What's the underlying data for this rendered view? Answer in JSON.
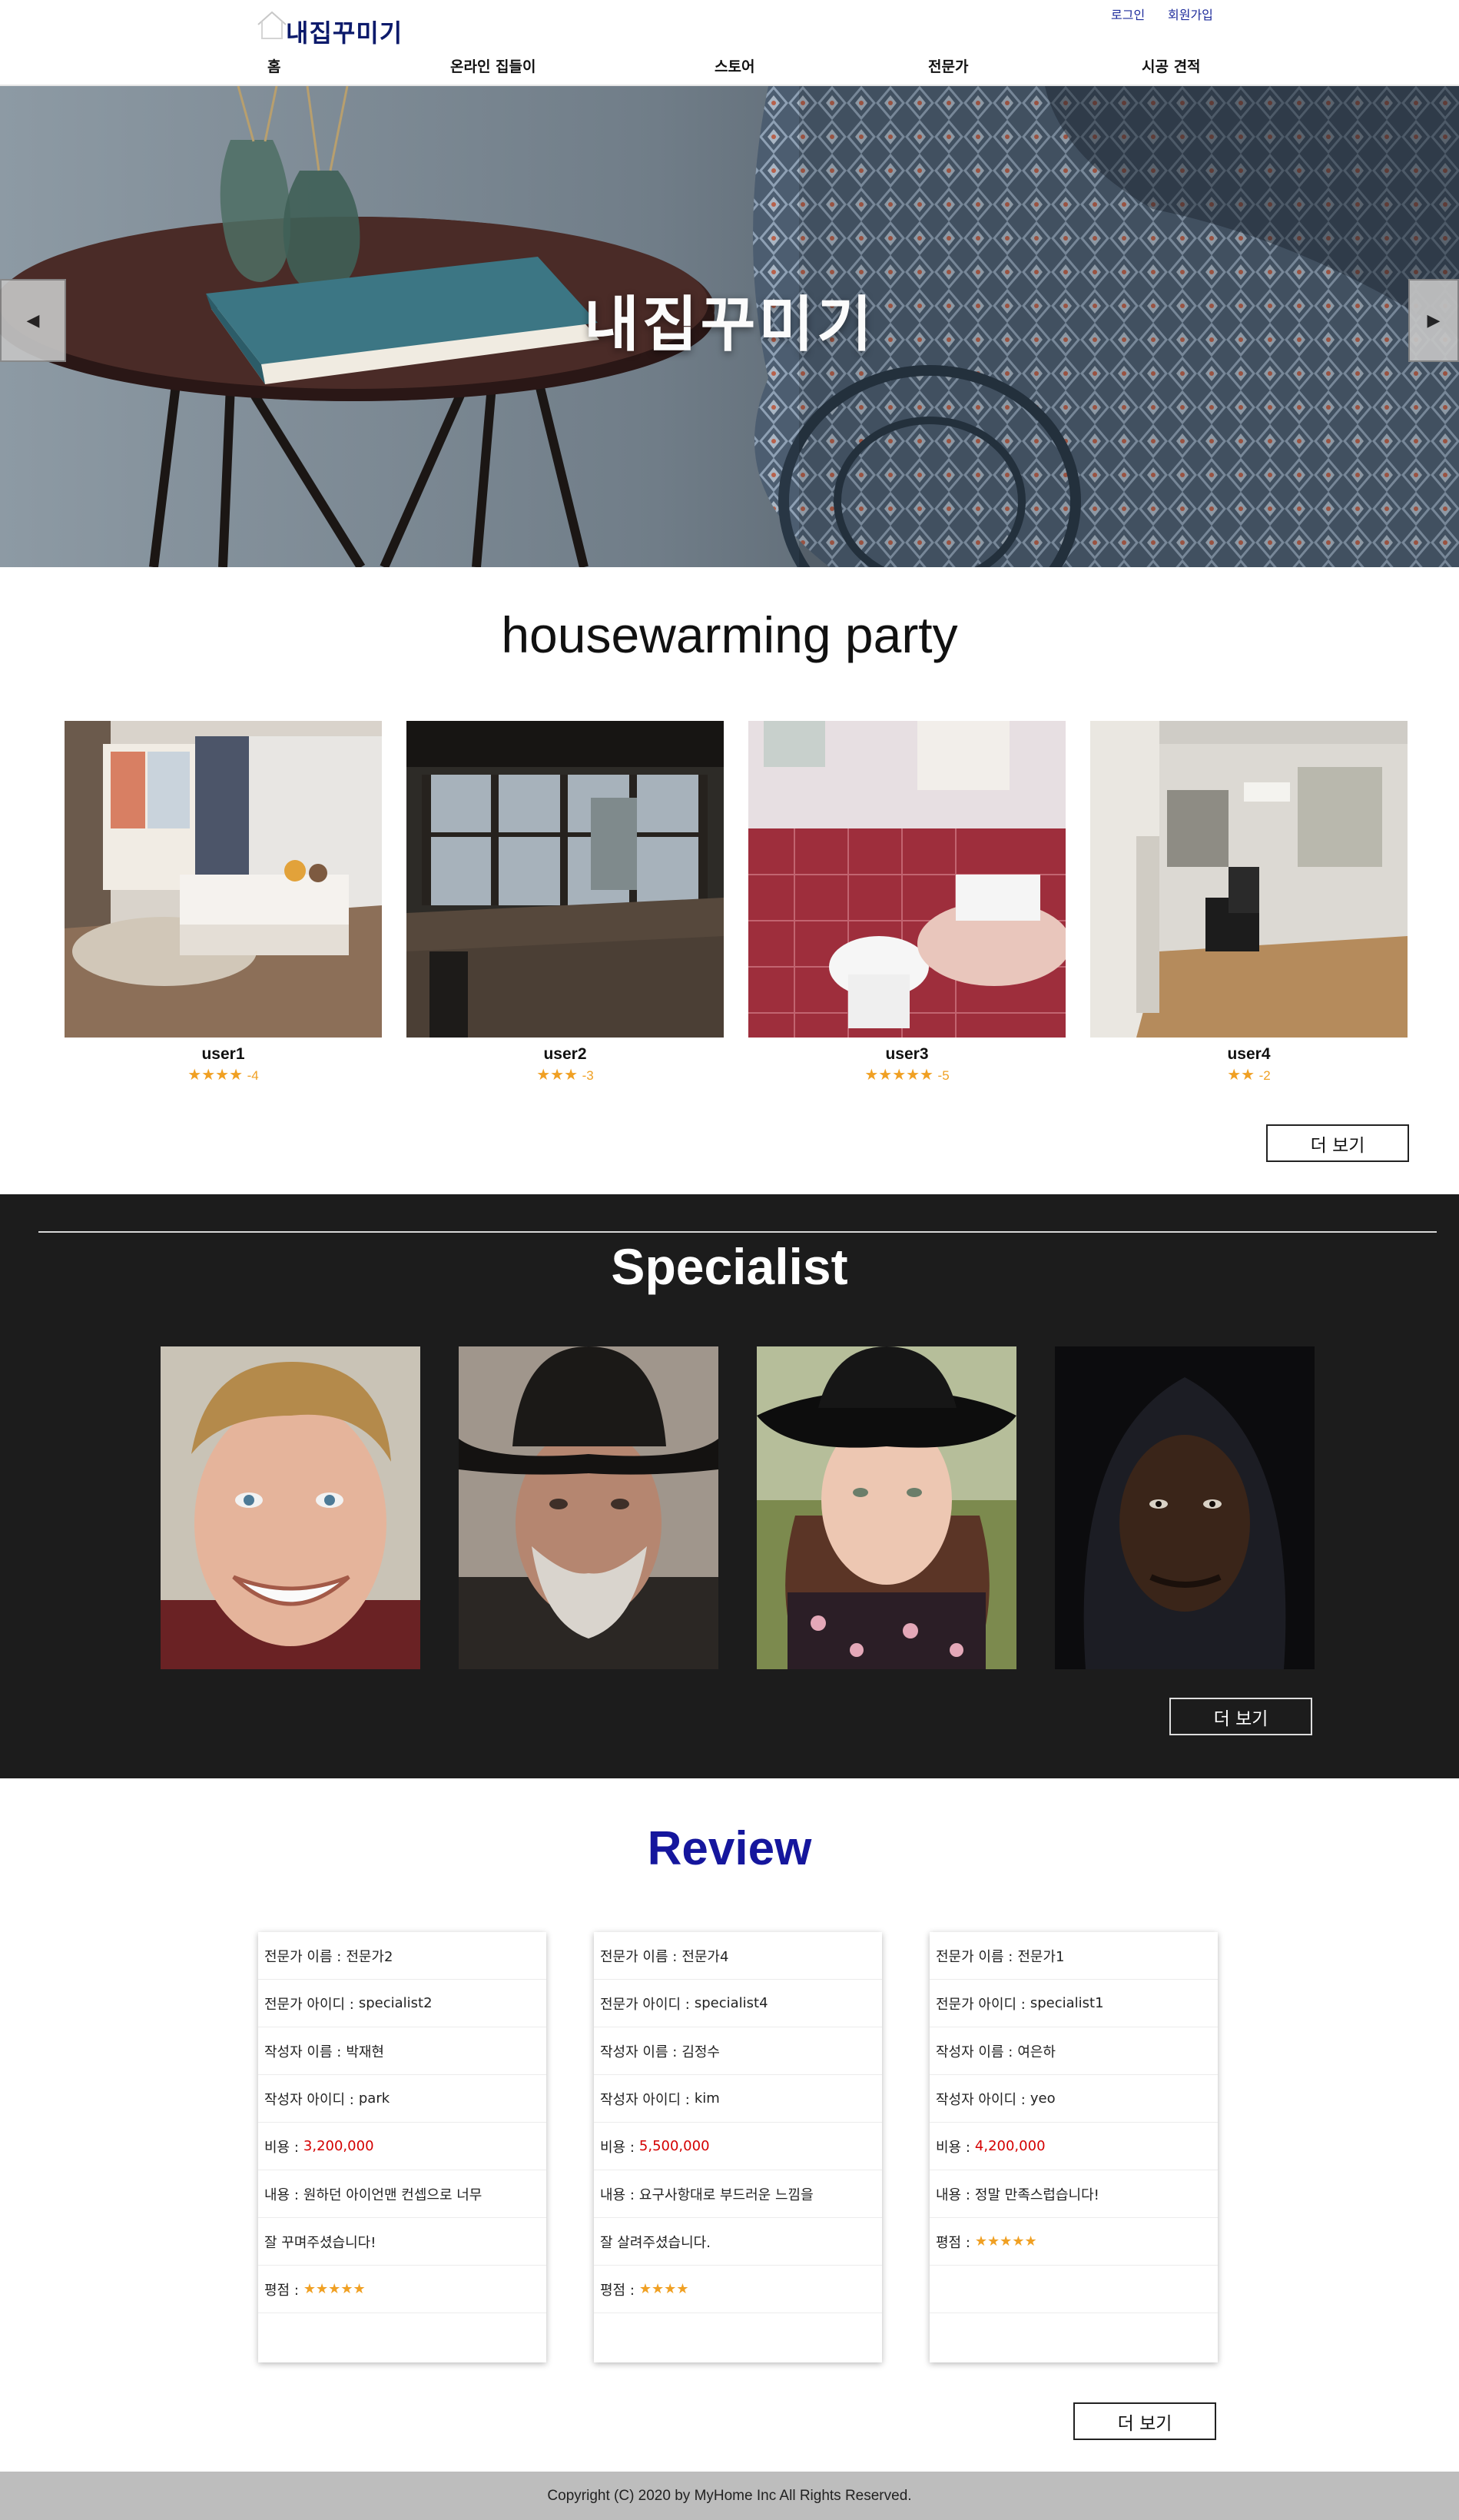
{
  "header": {
    "logo_text": "내집꾸미기",
    "login": "로그인",
    "signup": "회원가입",
    "nav": [
      "홈",
      "온라인 집들이",
      "스토어",
      "전문가",
      "시공 견적"
    ]
  },
  "hero": {
    "title": "내집꾸미기",
    "prev_icon": "◀",
    "next_icon": "▶"
  },
  "housewarming": {
    "title": "housewarming party",
    "cards": [
      {
        "user": "user1",
        "stars": "★★★★",
        "score": "-4"
      },
      {
        "user": "user2",
        "stars": "★★★",
        "score": "-3"
      },
      {
        "user": "user3",
        "stars": "★★★★★",
        "score": "-5"
      },
      {
        "user": "user4",
        "stars": "★★",
        "score": "-2"
      }
    ],
    "more": "더 보기"
  },
  "specialist": {
    "title": "Specialist",
    "more": "더 보기"
  },
  "review": {
    "title": "Review",
    "more": "더 보기",
    "cards": [
      {
        "name_label": "전문가 이름 :",
        "name": "전문가2",
        "id_label": "전문가 아이디 :",
        "id": "specialist2",
        "writer_label": "작성자 이름 :",
        "writer": "박재현",
        "writer_id_label": "작성자 아이디 :",
        "writer_id": "park",
        "cost_label": "비용 :",
        "cost": "3,200,000",
        "content_label": "내용 :",
        "content_1": "원하던 아이언맨 컨셉으로 너무",
        "content_2": "잘 꾸며주셨습니다!",
        "score_label": "평점 :",
        "score": "★★★★★"
      },
      {
        "name_label": "전문가 이름 :",
        "name": "전문가4",
        "id_label": "전문가 아이디 :",
        "id": "specialist4",
        "writer_label": "작성자 이름 :",
        "writer": "김정수",
        "writer_id_label": "작성자 아이디 :",
        "writer_id": "kim",
        "cost_label": "비용 :",
        "cost": "5,500,000",
        "content_label": "내용 :",
        "content_1": "요구사항대로 부드러운 느낌을",
        "content_2": "잘 살려주셨습니다.",
        "score_label": "평점 :",
        "score": "★★★★"
      },
      {
        "name_label": "전문가 이름 :",
        "name": "전문가1",
        "id_label": "전문가 아이디 :",
        "id": "specialist1",
        "writer_label": "작성자 이름 :",
        "writer": "여은하",
        "writer_id_label": "작성자 아이디 :",
        "writer_id": "yeo",
        "cost_label": "비용 :",
        "cost": "4,200,000",
        "content_label": "내용 :",
        "content_1": "정말 만족스럽습니다!",
        "score_label": "평점 :",
        "score": "★★★★★"
      }
    ]
  },
  "footer": {
    "copyright": "Copyright (C) 2020 by MyHome Inc All Rights Reserved."
  },
  "colors": {
    "brand_navy": "#0c1a6b",
    "review_title": "#15169d",
    "star": "#f0a023",
    "price_red": "#d40000",
    "specialist_bg": "#1c1c1c",
    "footer_bg": "#bdbdbd"
  },
  "icons": [
    "house-logo-icon",
    "chevron-left-icon",
    "chevron-right-icon",
    "star-icon"
  ]
}
